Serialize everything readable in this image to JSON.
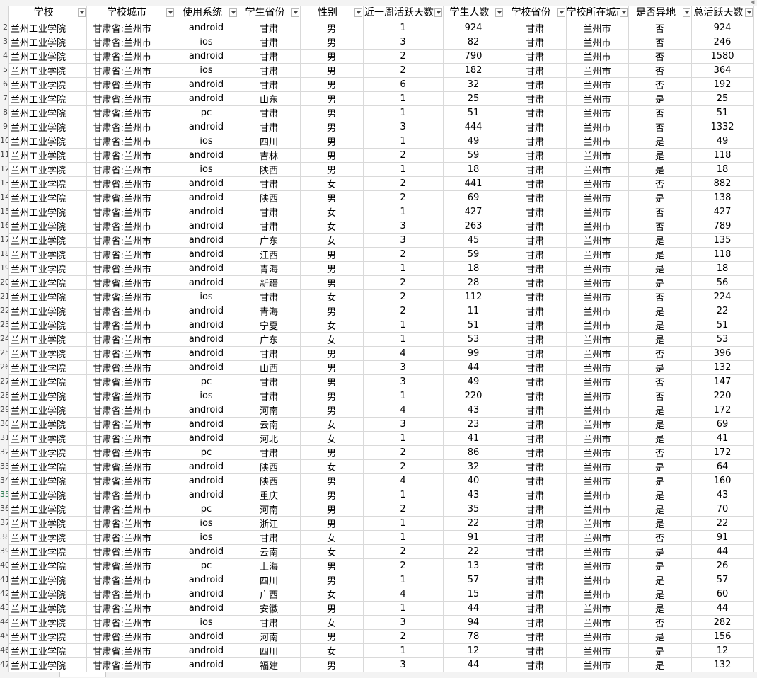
{
  "headers": [
    "学校",
    "学校城市",
    "使用系统",
    "学生省份",
    "性别",
    "近一周活跃天数",
    "学生人数",
    "学校省份",
    "学校所在城市",
    "是否异地",
    "总活跃天数"
  ],
  "row_numbers": [
    "2",
    "3",
    "4",
    "5",
    "6",
    "7",
    "8",
    "9",
    "10",
    "11",
    "12",
    "13",
    "14",
    "15",
    "16",
    "17",
    "18",
    "19",
    "20",
    "21",
    "22",
    "23",
    "24",
    "25",
    "26",
    "27",
    "28",
    "29",
    "30",
    "31",
    "32",
    "33",
    "34",
    "35",
    "36",
    "37",
    "38",
    "39",
    "40",
    "41",
    "42",
    "43",
    "44",
    "45",
    "46",
    "47"
  ],
  "rows": [
    [
      "兰州工业学院",
      "甘肃省:兰州市",
      "android",
      "甘肃",
      "男",
      "1",
      "924",
      "甘肃",
      "兰州市",
      "否",
      "924"
    ],
    [
      "兰州工业学院",
      "甘肃省:兰州市",
      "ios",
      "甘肃",
      "男",
      "3",
      "82",
      "甘肃",
      "兰州市",
      "否",
      "246"
    ],
    [
      "兰州工业学院",
      "甘肃省:兰州市",
      "android",
      "甘肃",
      "男",
      "2",
      "790",
      "甘肃",
      "兰州市",
      "否",
      "1580"
    ],
    [
      "兰州工业学院",
      "甘肃省:兰州市",
      "ios",
      "甘肃",
      "男",
      "2",
      "182",
      "甘肃",
      "兰州市",
      "否",
      "364"
    ],
    [
      "兰州工业学院",
      "甘肃省:兰州市",
      "android",
      "甘肃",
      "男",
      "6",
      "32",
      "甘肃",
      "兰州市",
      "否",
      "192"
    ],
    [
      "兰州工业学院",
      "甘肃省:兰州市",
      "android",
      "山东",
      "男",
      "1",
      "25",
      "甘肃",
      "兰州市",
      "是",
      "25"
    ],
    [
      "兰州工业学院",
      "甘肃省:兰州市",
      "pc",
      "甘肃",
      "男",
      "1",
      "51",
      "甘肃",
      "兰州市",
      "否",
      "51"
    ],
    [
      "兰州工业学院",
      "甘肃省:兰州市",
      "android",
      "甘肃",
      "男",
      "3",
      "444",
      "甘肃",
      "兰州市",
      "否",
      "1332"
    ],
    [
      "兰州工业学院",
      "甘肃省:兰州市",
      "ios",
      "四川",
      "男",
      "1",
      "49",
      "甘肃",
      "兰州市",
      "是",
      "49"
    ],
    [
      "兰州工业学院",
      "甘肃省:兰州市",
      "android",
      "吉林",
      "男",
      "2",
      "59",
      "甘肃",
      "兰州市",
      "是",
      "118"
    ],
    [
      "兰州工业学院",
      "甘肃省:兰州市",
      "ios",
      "陕西",
      "男",
      "1",
      "18",
      "甘肃",
      "兰州市",
      "是",
      "18"
    ],
    [
      "兰州工业学院",
      "甘肃省:兰州市",
      "android",
      "甘肃",
      "女",
      "2",
      "441",
      "甘肃",
      "兰州市",
      "否",
      "882"
    ],
    [
      "兰州工业学院",
      "甘肃省:兰州市",
      "android",
      "陕西",
      "男",
      "2",
      "69",
      "甘肃",
      "兰州市",
      "是",
      "138"
    ],
    [
      "兰州工业学院",
      "甘肃省:兰州市",
      "android",
      "甘肃",
      "女",
      "1",
      "427",
      "甘肃",
      "兰州市",
      "否",
      "427"
    ],
    [
      "兰州工业学院",
      "甘肃省:兰州市",
      "android",
      "甘肃",
      "女",
      "3",
      "263",
      "甘肃",
      "兰州市",
      "否",
      "789"
    ],
    [
      "兰州工业学院",
      "甘肃省:兰州市",
      "android",
      "广东",
      "女",
      "3",
      "45",
      "甘肃",
      "兰州市",
      "是",
      "135"
    ],
    [
      "兰州工业学院",
      "甘肃省:兰州市",
      "android",
      "江西",
      "男",
      "2",
      "59",
      "甘肃",
      "兰州市",
      "是",
      "118"
    ],
    [
      "兰州工业学院",
      "甘肃省:兰州市",
      "android",
      "青海",
      "男",
      "1",
      "18",
      "甘肃",
      "兰州市",
      "是",
      "18"
    ],
    [
      "兰州工业学院",
      "甘肃省:兰州市",
      "android",
      "新疆",
      "男",
      "2",
      "28",
      "甘肃",
      "兰州市",
      "是",
      "56"
    ],
    [
      "兰州工业学院",
      "甘肃省:兰州市",
      "ios",
      "甘肃",
      "女",
      "2",
      "112",
      "甘肃",
      "兰州市",
      "否",
      "224"
    ],
    [
      "兰州工业学院",
      "甘肃省:兰州市",
      "android",
      "青海",
      "男",
      "2",
      "11",
      "甘肃",
      "兰州市",
      "是",
      "22"
    ],
    [
      "兰州工业学院",
      "甘肃省:兰州市",
      "android",
      "宁夏",
      "女",
      "1",
      "51",
      "甘肃",
      "兰州市",
      "是",
      "51"
    ],
    [
      "兰州工业学院",
      "甘肃省:兰州市",
      "android",
      "广东",
      "女",
      "1",
      "53",
      "甘肃",
      "兰州市",
      "是",
      "53"
    ],
    [
      "兰州工业学院",
      "甘肃省:兰州市",
      "android",
      "甘肃",
      "男",
      "4",
      "99",
      "甘肃",
      "兰州市",
      "否",
      "396"
    ],
    [
      "兰州工业学院",
      "甘肃省:兰州市",
      "android",
      "山西",
      "男",
      "3",
      "44",
      "甘肃",
      "兰州市",
      "是",
      "132"
    ],
    [
      "兰州工业学院",
      "甘肃省:兰州市",
      "pc",
      "甘肃",
      "男",
      "3",
      "49",
      "甘肃",
      "兰州市",
      "否",
      "147"
    ],
    [
      "兰州工业学院",
      "甘肃省:兰州市",
      "ios",
      "甘肃",
      "男",
      "1",
      "220",
      "甘肃",
      "兰州市",
      "否",
      "220"
    ],
    [
      "兰州工业学院",
      "甘肃省:兰州市",
      "android",
      "河南",
      "男",
      "4",
      "43",
      "甘肃",
      "兰州市",
      "是",
      "172"
    ],
    [
      "兰州工业学院",
      "甘肃省:兰州市",
      "android",
      "云南",
      "女",
      "3",
      "23",
      "甘肃",
      "兰州市",
      "是",
      "69"
    ],
    [
      "兰州工业学院",
      "甘肃省:兰州市",
      "android",
      "河北",
      "女",
      "1",
      "41",
      "甘肃",
      "兰州市",
      "是",
      "41"
    ],
    [
      "兰州工业学院",
      "甘肃省:兰州市",
      "pc",
      "甘肃",
      "男",
      "2",
      "86",
      "甘肃",
      "兰州市",
      "否",
      "172"
    ],
    [
      "兰州工业学院",
      "甘肃省:兰州市",
      "android",
      "陕西",
      "女",
      "2",
      "32",
      "甘肃",
      "兰州市",
      "是",
      "64"
    ],
    [
      "兰州工业学院",
      "甘肃省:兰州市",
      "android",
      "陕西",
      "男",
      "4",
      "40",
      "甘肃",
      "兰州市",
      "是",
      "160"
    ],
    [
      "兰州工业学院",
      "甘肃省:兰州市",
      "android",
      "重庆",
      "男",
      "1",
      "43",
      "甘肃",
      "兰州市",
      "是",
      "43"
    ],
    [
      "兰州工业学院",
      "甘肃省:兰州市",
      "pc",
      "河南",
      "男",
      "2",
      "35",
      "甘肃",
      "兰州市",
      "是",
      "70"
    ],
    [
      "兰州工业学院",
      "甘肃省:兰州市",
      "ios",
      "浙江",
      "男",
      "1",
      "22",
      "甘肃",
      "兰州市",
      "是",
      "22"
    ],
    [
      "兰州工业学院",
      "甘肃省:兰州市",
      "ios",
      "甘肃",
      "女",
      "1",
      "91",
      "甘肃",
      "兰州市",
      "否",
      "91"
    ],
    [
      "兰州工业学院",
      "甘肃省:兰州市",
      "android",
      "云南",
      "女",
      "2",
      "22",
      "甘肃",
      "兰州市",
      "是",
      "44"
    ],
    [
      "兰州工业学院",
      "甘肃省:兰州市",
      "pc",
      "上海",
      "男",
      "2",
      "13",
      "甘肃",
      "兰州市",
      "是",
      "26"
    ],
    [
      "兰州工业学院",
      "甘肃省:兰州市",
      "android",
      "四川",
      "男",
      "1",
      "57",
      "甘肃",
      "兰州市",
      "是",
      "57"
    ],
    [
      "兰州工业学院",
      "甘肃省:兰州市",
      "android",
      "广西",
      "女",
      "4",
      "15",
      "甘肃",
      "兰州市",
      "是",
      "60"
    ],
    [
      "兰州工业学院",
      "甘肃省:兰州市",
      "android",
      "安徽",
      "男",
      "1",
      "44",
      "甘肃",
      "兰州市",
      "是",
      "44"
    ],
    [
      "兰州工业学院",
      "甘肃省:兰州市",
      "ios",
      "甘肃",
      "女",
      "3",
      "94",
      "甘肃",
      "兰州市",
      "否",
      "282"
    ],
    [
      "兰州工业学院",
      "甘肃省:兰州市",
      "android",
      "河南",
      "男",
      "2",
      "78",
      "甘肃",
      "兰州市",
      "是",
      "156"
    ],
    [
      "兰州工业学院",
      "甘肃省:兰州市",
      "android",
      "四川",
      "女",
      "1",
      "12",
      "甘肃",
      "兰州市",
      "是",
      "12"
    ],
    [
      "兰州工业学院",
      "甘肃省:兰州市",
      "android",
      "福建",
      "男",
      "3",
      "44",
      "甘肃",
      "兰州市",
      "是",
      "132"
    ]
  ]
}
